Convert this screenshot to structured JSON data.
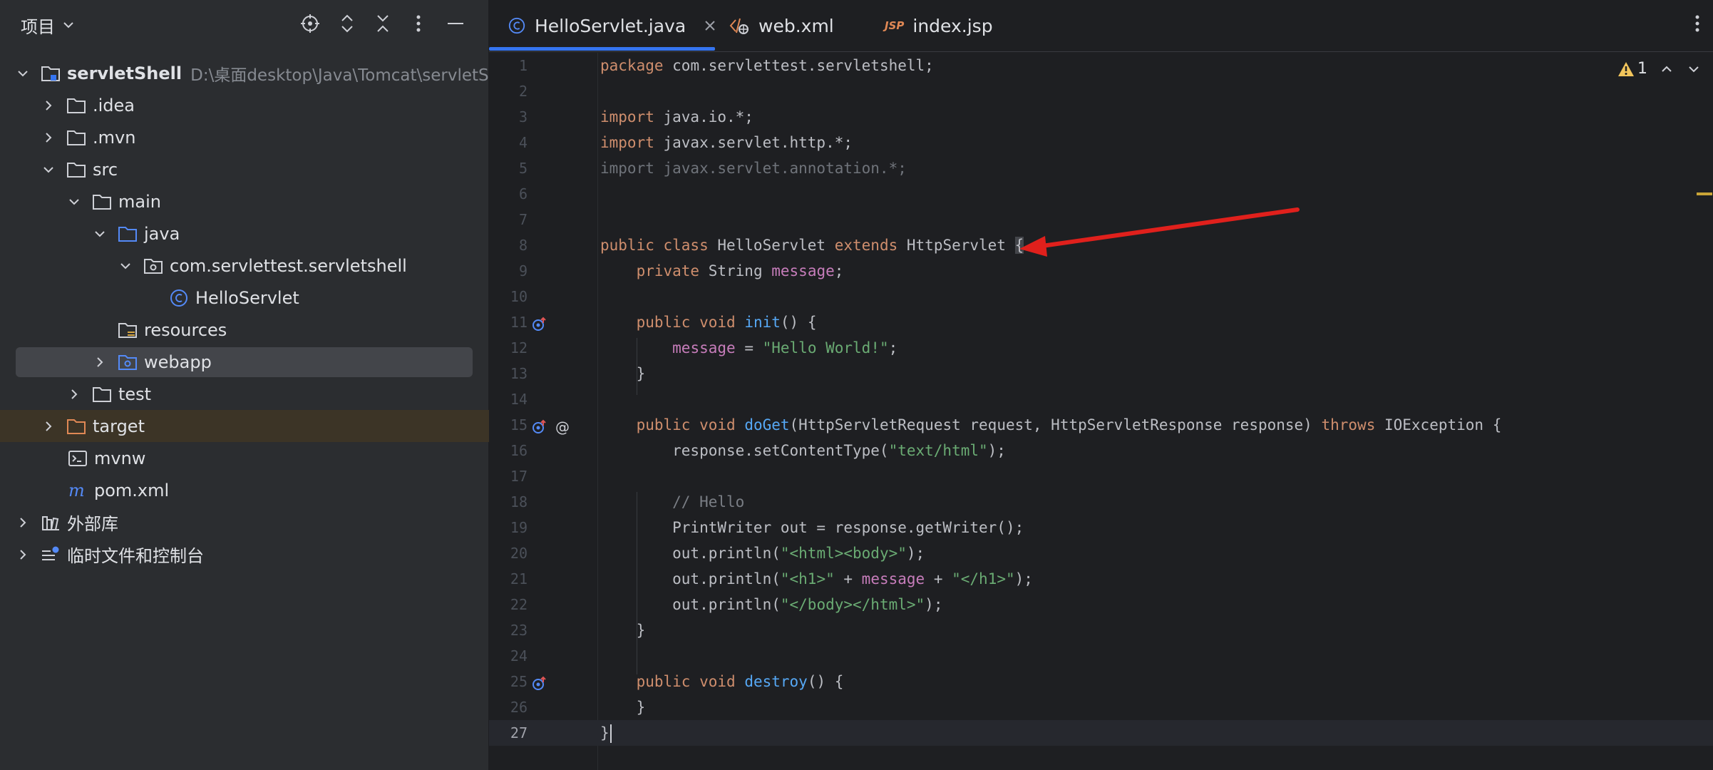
{
  "project_panel": {
    "title": "项目",
    "tree": [
      {
        "label": "servletShell",
        "hint": "D:\\桌面desktop\\Java\\Tomcat\\servletS",
        "bold": true
      },
      {
        "label": ".idea"
      },
      {
        "label": ".mvn"
      },
      {
        "label": "src"
      },
      {
        "label": "main"
      },
      {
        "label": "java"
      },
      {
        "label": "com.servlettest.servletshell"
      },
      {
        "label": "HelloServlet"
      },
      {
        "label": "resources"
      },
      {
        "label": "webapp"
      },
      {
        "label": "test"
      },
      {
        "label": "target"
      },
      {
        "label": "mvnw"
      },
      {
        "label": "pom.xml"
      },
      {
        "label": "外部库"
      },
      {
        "label": "临时文件和控制台"
      }
    ]
  },
  "editor": {
    "tabs": [
      {
        "label": "HelloServlet.java",
        "active": true
      },
      {
        "label": "web.xml"
      },
      {
        "label": "index.jsp",
        "icon_text": "JSP"
      }
    ],
    "inspection_count": "1",
    "colors": {
      "accent": "#3574f0",
      "arrow": "#e0201c",
      "warning": "#c9a437"
    },
    "lines": [
      {
        "n": "1",
        "segs": [
          [
            "kw",
            "package"
          ],
          [
            "plain",
            " com.servlettest.servletshell;"
          ]
        ]
      },
      {
        "n": "2",
        "segs": []
      },
      {
        "n": "3",
        "segs": [
          [
            "kw",
            "import"
          ],
          [
            "plain",
            " java.io.*;"
          ]
        ]
      },
      {
        "n": "4",
        "segs": [
          [
            "kw",
            "import"
          ],
          [
            "plain",
            " javax.servlet.http.*;"
          ]
        ]
      },
      {
        "n": "5",
        "segs": [
          [
            "dim",
            "import javax.servlet.annotation.*;"
          ]
        ]
      },
      {
        "n": "6",
        "segs": []
      },
      {
        "n": "7",
        "segs": []
      },
      {
        "n": "8",
        "segs": [
          [
            "kw",
            "public class"
          ],
          [
            "plain",
            " HelloServlet "
          ],
          [
            "kw",
            "extends"
          ],
          [
            "plain",
            " HttpServlet "
          ],
          [
            "brace",
            "{"
          ]
        ]
      },
      {
        "n": "9",
        "segs": [
          [
            "plain",
            "    "
          ],
          [
            "kw",
            "private"
          ],
          [
            "plain",
            " String "
          ],
          [
            "fld",
            "message"
          ],
          [
            "plain",
            ";"
          ]
        ]
      },
      {
        "n": "10",
        "segs": []
      },
      {
        "n": "11",
        "segs": [
          [
            "plain",
            "    "
          ],
          [
            "kw",
            "public void"
          ],
          [
            "plain",
            " "
          ],
          [
            "fn",
            "init"
          ],
          [
            "plain",
            "() {"
          ]
        ]
      },
      {
        "n": "12",
        "segs": [
          [
            "plain",
            "        "
          ],
          [
            "fld",
            "message"
          ],
          [
            "plain",
            " = "
          ],
          [
            "str",
            "\"Hello World!\""
          ],
          [
            "plain",
            ";"
          ]
        ]
      },
      {
        "n": "13",
        "segs": [
          [
            "plain",
            "    }"
          ]
        ]
      },
      {
        "n": "14",
        "segs": []
      },
      {
        "n": "15",
        "segs": [
          [
            "plain",
            "    "
          ],
          [
            "kw",
            "public void"
          ],
          [
            "plain",
            " "
          ],
          [
            "fn",
            "doGet"
          ],
          [
            "plain",
            "(HttpServletRequest request, HttpServletResponse response) "
          ],
          [
            "kw",
            "throws"
          ],
          [
            "plain",
            " IOException {"
          ]
        ]
      },
      {
        "n": "16",
        "segs": [
          [
            "plain",
            "        response.setContentType("
          ],
          [
            "str",
            "\"text/html\""
          ],
          [
            "plain",
            ");"
          ]
        ]
      },
      {
        "n": "17",
        "segs": []
      },
      {
        "n": "18",
        "segs": [
          [
            "plain",
            "        "
          ],
          [
            "cmt",
            "// Hello"
          ]
        ]
      },
      {
        "n": "19",
        "segs": [
          [
            "plain",
            "        PrintWriter out = response.getWriter();"
          ]
        ]
      },
      {
        "n": "20",
        "segs": [
          [
            "plain",
            "        out.println("
          ],
          [
            "str",
            "\"<html><body>\""
          ],
          [
            "plain",
            ");"
          ]
        ]
      },
      {
        "n": "21",
        "segs": [
          [
            "plain",
            "        out.println("
          ],
          [
            "str",
            "\"<h1>\""
          ],
          [
            "plain",
            " + "
          ],
          [
            "fld",
            "message"
          ],
          [
            "plain",
            " + "
          ],
          [
            "str",
            "\"</h1>\""
          ],
          [
            "plain",
            ");"
          ]
        ]
      },
      {
        "n": "22",
        "segs": [
          [
            "plain",
            "        out.println("
          ],
          [
            "str",
            "\"</body></html>\""
          ],
          [
            "plain",
            ");"
          ]
        ]
      },
      {
        "n": "23",
        "segs": [
          [
            "plain",
            "    }"
          ]
        ]
      },
      {
        "n": "24",
        "segs": []
      },
      {
        "n": "25",
        "segs": [
          [
            "plain",
            "    "
          ],
          [
            "kw",
            "public void"
          ],
          [
            "plain",
            " "
          ],
          [
            "fn",
            "destroy"
          ],
          [
            "plain",
            "() {"
          ]
        ]
      },
      {
        "n": "26",
        "segs": [
          [
            "plain",
            "    }"
          ]
        ]
      },
      {
        "n": "27",
        "segs": [
          [
            "plain",
            "}"
          ]
        ]
      }
    ]
  }
}
